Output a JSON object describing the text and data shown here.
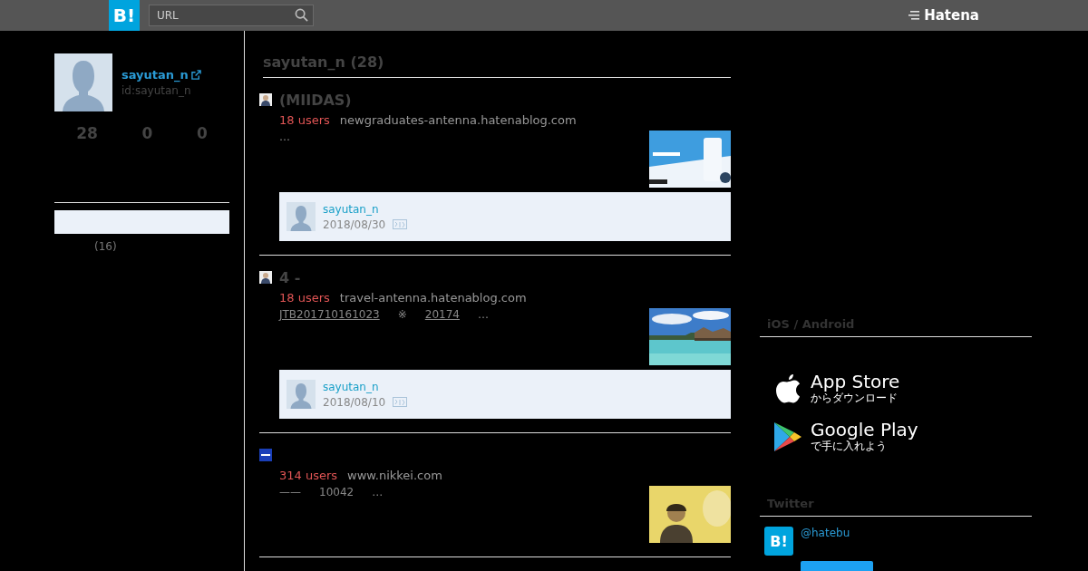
{
  "header": {
    "logo": "B!",
    "search": {
      "placeholder": "URL"
    },
    "brand": "Hatena"
  },
  "profile": {
    "name": "sayutan_n",
    "id": "id:sayutan_n",
    "stats": [
      "28",
      "0",
      "0"
    ],
    "category_count": "(16)"
  },
  "main": {
    "heading": "sayutan_n (28)",
    "entries": [
      {
        "title": "(MIIDAS)",
        "users": "18 users",
        "domain": "newgraduates-antenna.hatenablog.com",
        "excerpt": [
          {
            "text": "…",
            "link": false
          }
        ],
        "comment": {
          "user": "sayutan_n",
          "date": "2018/08/30"
        }
      },
      {
        "title": "4 -",
        "users": "18 users",
        "domain": "travel-antenna.hatenablog.com",
        "excerpt": [
          {
            "text": "JTB201710161023",
            "link": true
          },
          {
            "text": "※",
            "link": false
          },
          {
            "text": "20174",
            "link": true
          },
          {
            "text": "…",
            "link": false
          }
        ],
        "comment": {
          "user": "sayutan_n",
          "date": "2018/08/10"
        }
      },
      {
        "users": "314 users",
        "domain": "www.nikkei.com",
        "excerpt": [
          {
            "text": "——",
            "link": false
          },
          {
            "text": "10042",
            "link": false
          },
          {
            "text": "…",
            "link": false
          }
        ]
      }
    ]
  },
  "side": {
    "apps_heading": "iOS / Android",
    "app_store": {
      "title": "App Store",
      "sub": "からダウンロード"
    },
    "google_play": {
      "title": "Google Play",
      "sub": "で手に入れよう"
    },
    "twitter_heading": "Twitter",
    "twitter_logo": "B!",
    "twitter_account": "@hatebu"
  }
}
